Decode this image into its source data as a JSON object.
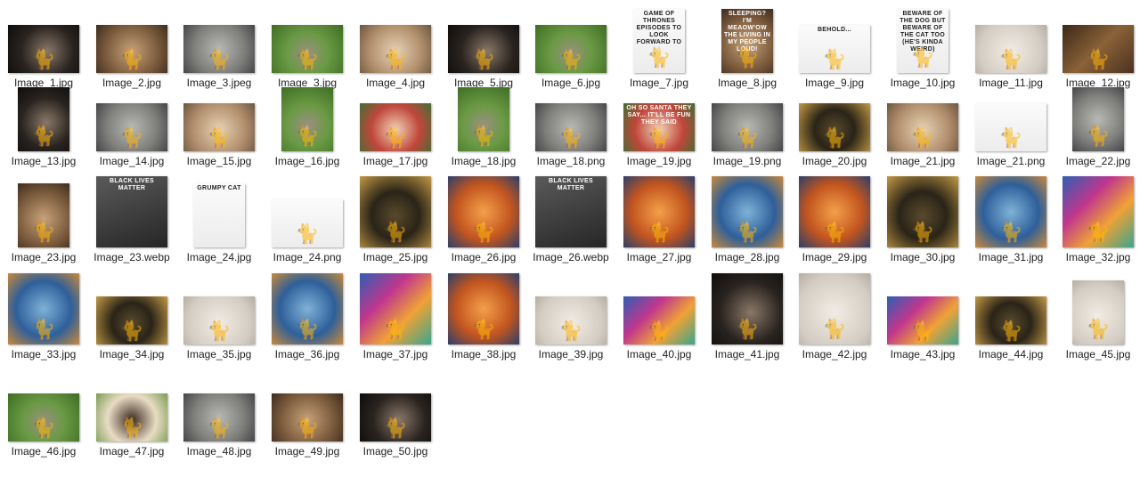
{
  "window": {
    "view": "Large icons"
  },
  "files": [
    {
      "name": "Image_1.jpg",
      "icon": "cat-photo-icon",
      "ratio": "wide",
      "palette": "dark"
    },
    {
      "name": "Image_2.jpg",
      "icon": "cat-photo-icon",
      "ratio": "wide",
      "palette": "brown"
    },
    {
      "name": "Image_3.jpeg",
      "icon": "cat-photo-icon",
      "ratio": "wide",
      "palette": "grey"
    },
    {
      "name": "Image_3.jpg",
      "icon": "cat-photo-icon",
      "ratio": "wide",
      "palette": "green"
    },
    {
      "name": "Image_4.jpg",
      "icon": "cat-photo-icon",
      "ratio": "wide",
      "palette": "tan"
    },
    {
      "name": "Image_5.jpg",
      "icon": "cat-photo-icon",
      "ratio": "wide",
      "palette": "dark"
    },
    {
      "name": "Image_6.jpg",
      "icon": "cat-photo-icon",
      "ratio": "wide",
      "palette": "green"
    },
    {
      "name": "Image_7.jpg",
      "icon": "meme-icon",
      "ratio": "tall",
      "palette": "white",
      "caption": "Game of Thrones episodes to look forward to"
    },
    {
      "name": "Image_8.jpg",
      "icon": "meme-icon",
      "ratio": "tall",
      "palette": "brown",
      "caption": "SLEEPING? I'M MEAOW'OW THE LIVING IN MY PEOPLE LOUD!"
    },
    {
      "name": "Image_9.jpg",
      "icon": "meme-icon",
      "ratio": "wide",
      "palette": "white",
      "caption": "BEHOLD..."
    },
    {
      "name": "Image_10.jpg",
      "icon": "meme-icon",
      "ratio": "tall",
      "palette": "white",
      "caption": "Beware of the Dog But beware of the cat too (he's kinda weird)"
    },
    {
      "name": "Image_11.jpg",
      "icon": "cat-photo-icon",
      "ratio": "wide",
      "palette": "light"
    },
    {
      "name": "Image_12.jpg",
      "icon": "cat-photo-icon",
      "ratio": "wide",
      "palette": "wood"
    },
    {
      "name": "Image_13.jpg",
      "icon": "cat-photo-icon",
      "ratio": "tall",
      "palette": "dark"
    },
    {
      "name": "Image_14.jpg",
      "icon": "cat-photo-icon",
      "ratio": "wide",
      "palette": "grey"
    },
    {
      "name": "Image_15.jpg",
      "icon": "cat-photo-icon",
      "ratio": "wide",
      "palette": "tan"
    },
    {
      "name": "Image_16.jpg",
      "icon": "cat-photo-icon",
      "ratio": "tall",
      "palette": "green"
    },
    {
      "name": "Image_17.jpg",
      "icon": "cat-photo-icon",
      "ratio": "wide",
      "palette": "red"
    },
    {
      "name": "Image_18.jpg",
      "icon": "cat-photo-icon",
      "ratio": "tall",
      "palette": "green"
    },
    {
      "name": "Image_18.png",
      "icon": "cat-photo-icon",
      "ratio": "wide",
      "palette": "grey"
    },
    {
      "name": "Image_19.jpg",
      "icon": "meme-icon",
      "ratio": "wide",
      "palette": "red",
      "caption": "OH SO SANTA THEY SAY... IT'LL BE FUN THEY SAID"
    },
    {
      "name": "Image_19.png",
      "icon": "cat-photo-icon",
      "ratio": "wide",
      "palette": "grey"
    },
    {
      "name": "Image_20.jpg",
      "icon": "cat-art-icon",
      "ratio": "wide",
      "palette": "gold"
    },
    {
      "name": "Image_21.jpg",
      "icon": "cat-photo-icon",
      "ratio": "wide",
      "palette": "tan"
    },
    {
      "name": "Image_21.png",
      "icon": "cat-photo-icon",
      "ratio": "wide",
      "palette": "white"
    },
    {
      "name": "Image_22.jpg",
      "icon": "cat-photo-icon",
      "ratio": "tall",
      "palette": "grey"
    },
    {
      "name": "Image_23.jpg",
      "icon": "cat-photo-icon",
      "ratio": "tall",
      "palette": "brown"
    },
    {
      "name": "Image_23.webp",
      "icon": "poster-icon",
      "ratio": "square",
      "palette": "bw",
      "caption": "BLACK LIVES MATTER"
    },
    {
      "name": "Image_24.jpg",
      "icon": "poster-icon",
      "ratio": "tall",
      "palette": "white",
      "caption": "GRUMPY CAT"
    },
    {
      "name": "Image_24.png",
      "icon": "cat-photo-icon",
      "ratio": "wide",
      "palette": "white"
    },
    {
      "name": "Image_25.jpg",
      "icon": "cat-art-icon",
      "ratio": "square",
      "palette": "gold"
    },
    {
      "name": "Image_26.jpg",
      "icon": "cat-art-icon",
      "ratio": "square",
      "palette": "orange"
    },
    {
      "name": "Image_26.webp",
      "icon": "poster-icon",
      "ratio": "square",
      "palette": "bw",
      "caption": "BLACK LIVES MATTER"
    },
    {
      "name": "Image_27.jpg",
      "icon": "cat-art-icon",
      "ratio": "square",
      "palette": "orange"
    },
    {
      "name": "Image_28.jpg",
      "icon": "cat-art-icon",
      "ratio": "square",
      "palette": "blue"
    },
    {
      "name": "Image_29.jpg",
      "icon": "cat-art-icon",
      "ratio": "square",
      "palette": "orange"
    },
    {
      "name": "Image_30.jpg",
      "icon": "cat-art-icon",
      "ratio": "square",
      "palette": "gold"
    },
    {
      "name": "Image_31.jpg",
      "icon": "cat-art-icon",
      "ratio": "square",
      "palette": "blue"
    },
    {
      "name": "Image_32.jpg",
      "icon": "cat-art-icon",
      "ratio": "square",
      "palette": "colorful"
    },
    {
      "name": "Image_33.jpg",
      "icon": "cat-art-icon",
      "ratio": "square",
      "palette": "blue"
    },
    {
      "name": "Image_34.jpg",
      "icon": "cat-art-icon",
      "ratio": "wide",
      "palette": "gold"
    },
    {
      "name": "Image_35.jpg",
      "icon": "cat-art-icon",
      "ratio": "wide",
      "palette": "light"
    },
    {
      "name": "Image_36.jpg",
      "icon": "cat-art-icon",
      "ratio": "square",
      "palette": "blue"
    },
    {
      "name": "Image_37.jpg",
      "icon": "cat-art-icon",
      "ratio": "square",
      "palette": "colorful"
    },
    {
      "name": "Image_38.jpg",
      "icon": "cat-art-icon",
      "ratio": "square",
      "palette": "orange"
    },
    {
      "name": "Image_39.jpg",
      "icon": "cat-art-icon",
      "ratio": "wide",
      "palette": "light"
    },
    {
      "name": "Image_40.jpg",
      "icon": "cat-art-icon",
      "ratio": "wide",
      "palette": "colorful"
    },
    {
      "name": "Image_41.jpg",
      "icon": "cat-art-icon",
      "ratio": "square",
      "palette": "dark"
    },
    {
      "name": "Image_42.jpg",
      "icon": "cat-art-icon",
      "ratio": "square",
      "palette": "light"
    },
    {
      "name": "Image_43.jpg",
      "icon": "cat-art-icon",
      "ratio": "wide",
      "palette": "colorful"
    },
    {
      "name": "Image_44.jpg",
      "icon": "cat-art-icon",
      "ratio": "wide",
      "palette": "gold"
    },
    {
      "name": "Image_45.jpg",
      "icon": "cat-photo-icon",
      "ratio": "tall",
      "palette": "light"
    },
    {
      "name": "Image_46.jpg",
      "icon": "cat-photo-icon",
      "ratio": "wide",
      "palette": "green"
    },
    {
      "name": "Image_47.jpg",
      "icon": "cat-photo-icon",
      "ratio": "wide",
      "palette": "cream"
    },
    {
      "name": "Image_48.jpg",
      "icon": "cat-photo-icon",
      "ratio": "wide",
      "palette": "grey"
    },
    {
      "name": "Image_49.jpg",
      "icon": "cat-photo-icon",
      "ratio": "wide",
      "palette": "brown"
    },
    {
      "name": "Image_50.jpg",
      "icon": "cat-photo-icon",
      "ratio": "wide",
      "palette": "dark"
    }
  ],
  "colors": {
    "label": "#1f1f1f",
    "background": "#ffffff",
    "dark": "#1d1a17",
    "brown": "#7a5a3c",
    "grey": "#8a8a88",
    "green": "#5f8f3e",
    "tan": "#b89a7a",
    "white": "#f2f2f2",
    "light": "#d9d4cc",
    "wood": "#6b4a2e",
    "red": "#b33a2e",
    "gold": "#a7802e",
    "orange": "#d9782a",
    "blue": "#2f5f9a",
    "colorful": "#8a4fb0",
    "bw": "#3a3a3a",
    "cream": "#e6d8bf"
  }
}
